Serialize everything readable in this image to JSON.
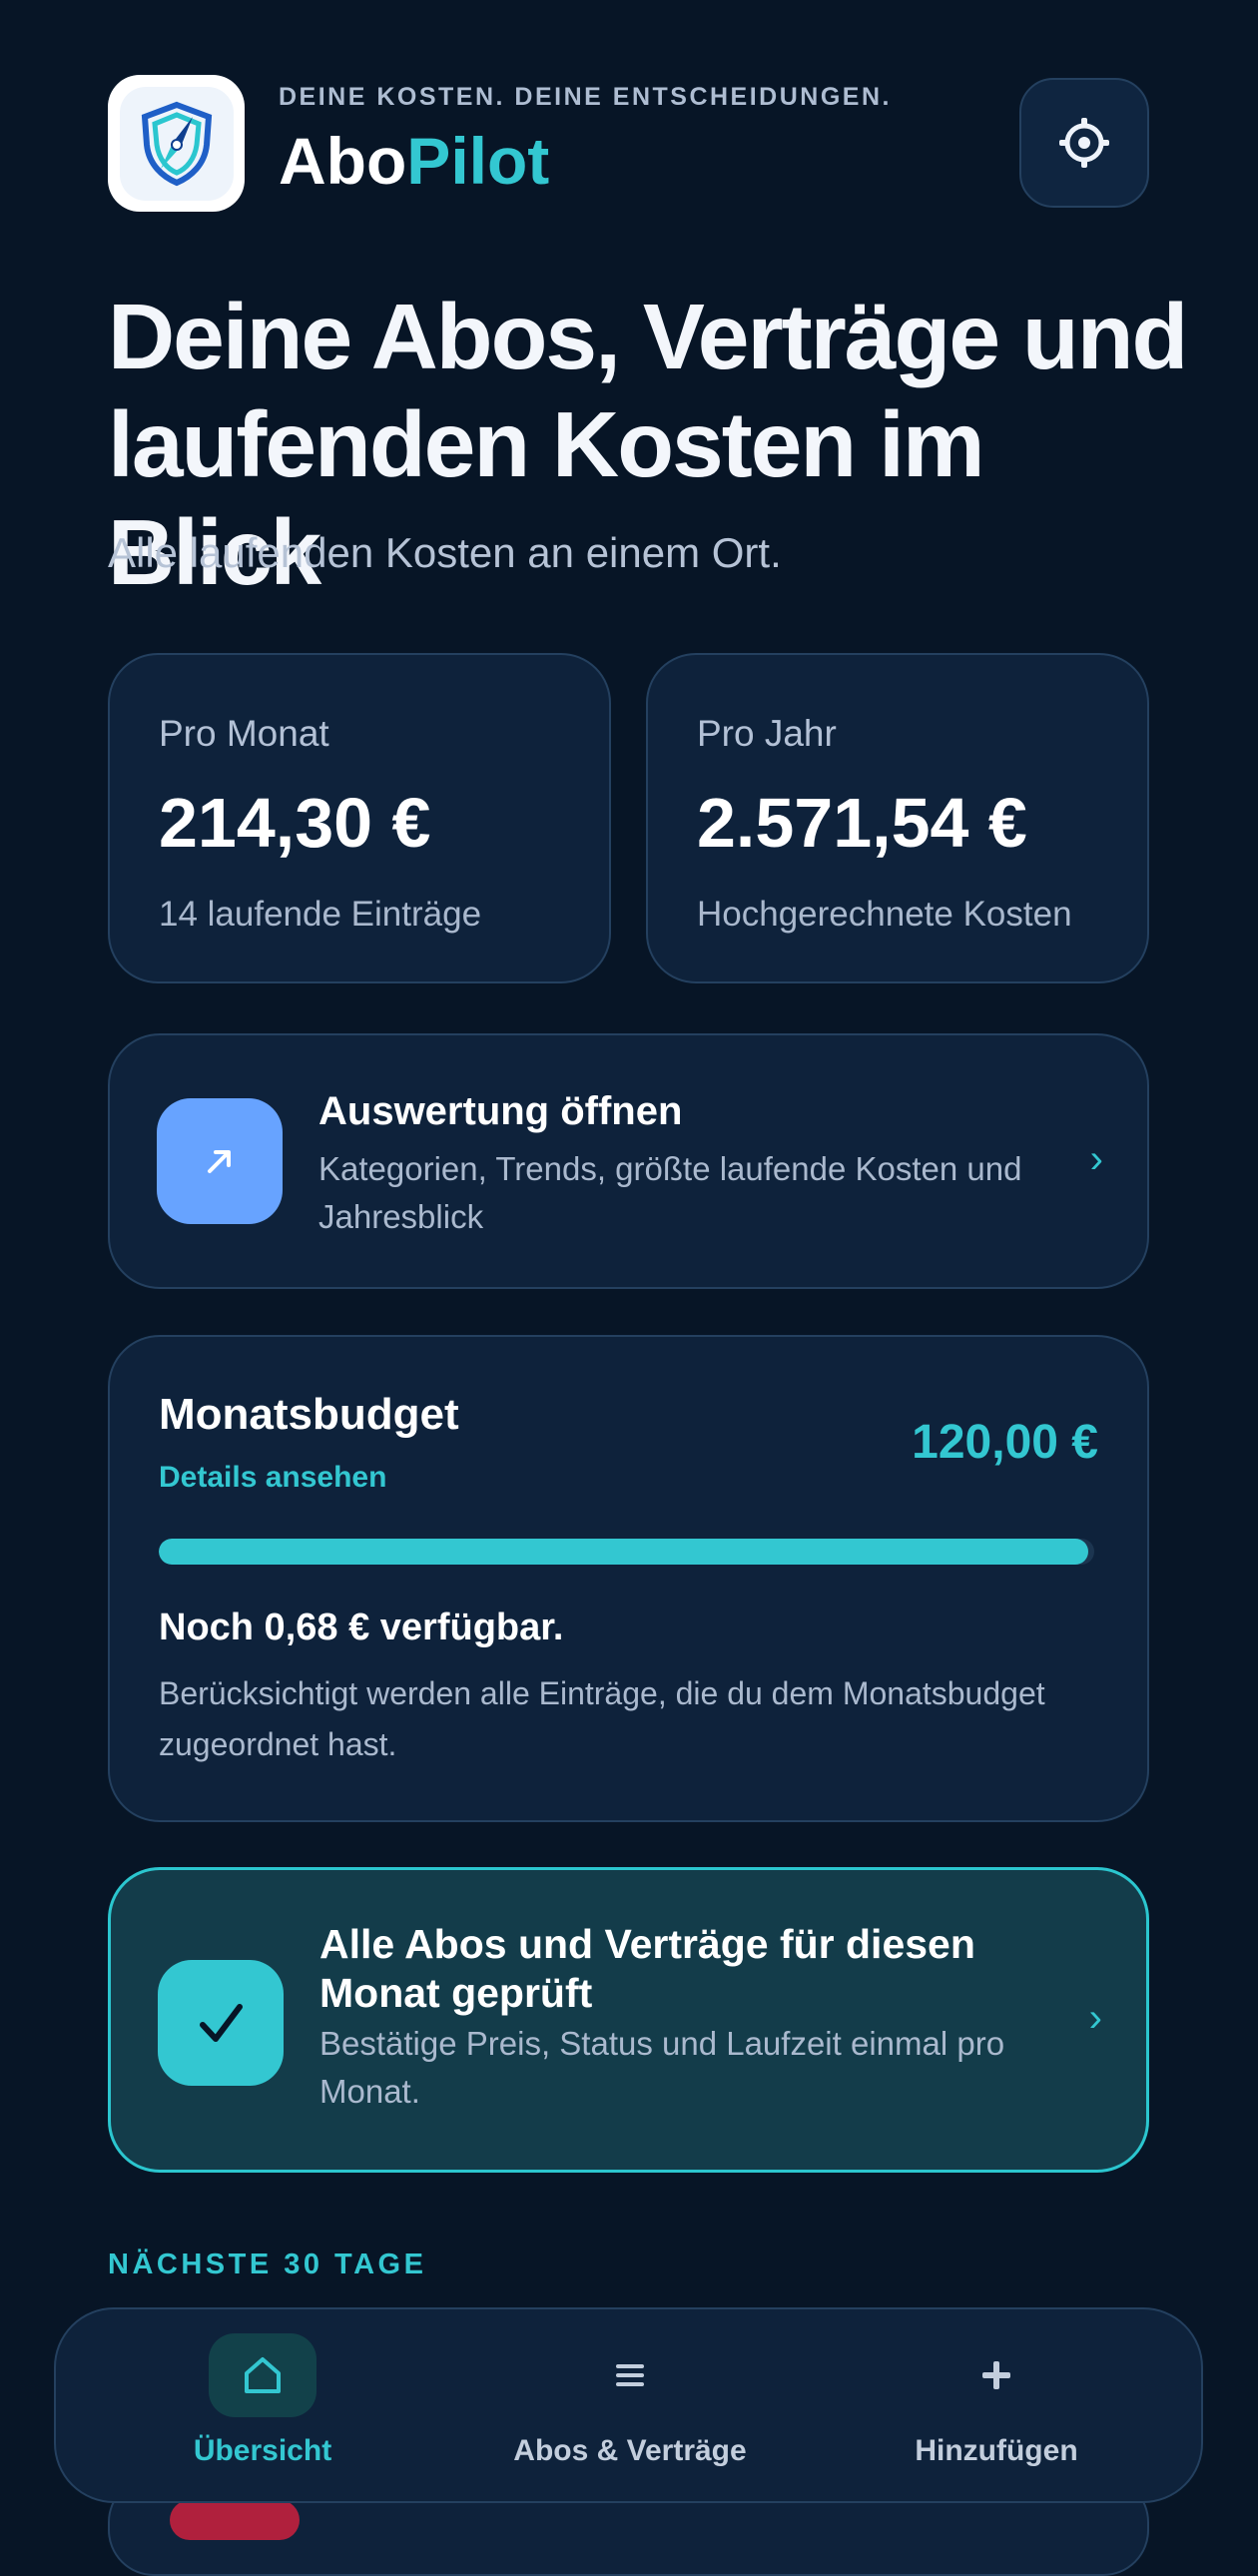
{
  "header": {
    "tagline": "DEINE KOSTEN. DEINE ENTSCHEIDUNGEN.",
    "brand_part1": "Abo",
    "brand_part2": "Pilot",
    "logo_icon": "shield-compass-icon",
    "settings_icon": "gear-icon"
  },
  "hero": {
    "title": "Deine Abos, Verträge und laufenden Kosten im Blick",
    "subtitle": "Alle laufenden Kosten an einem Ort."
  },
  "stats": [
    {
      "label": "Pro Monat",
      "value": "214,30 €",
      "note": "14 laufende Einträge"
    },
    {
      "label": "Pro Jahr",
      "value": "2.571,54 €",
      "note": "Hochgerechnete Kosten"
    }
  ],
  "insights": {
    "icon": "trend-arrow-icon",
    "title": "Auswertung öffnen",
    "description": "Kategorien, Trends, größte laufende Kosten und Jahresblick",
    "chevron": "›"
  },
  "budget": {
    "title": "Monatsbudget",
    "link": "Details ansehen",
    "amount": "120,00 €",
    "progress_fraction": 0.994,
    "remaining": "Noch 0,68 € verfügbar.",
    "description": "Berücksichtigt werden alle Einträge, die du dem Monatsbudget zugeordnet hast."
  },
  "check": {
    "icon": "checkmark-icon",
    "title": "Alle Abos und Verträge für diesen Monat geprüft",
    "description": "Bestätige Preis, Status und Laufzeit einmal pro Monat.",
    "chevron": "›"
  },
  "section_label": "NÄCHSTE 30 TAGE",
  "nav": [
    {
      "label": "Übersicht",
      "icon": "home-icon",
      "active": true
    },
    {
      "label": "Abos & Verträge",
      "icon": "list-icon",
      "active": false
    },
    {
      "label": "Hinzufügen",
      "icon": "plus-icon",
      "active": false
    }
  ],
  "colors": {
    "background": "#071526",
    "card": "#0e223b",
    "accent": "#33c7d1",
    "insights_tile": "#67a3ff"
  }
}
